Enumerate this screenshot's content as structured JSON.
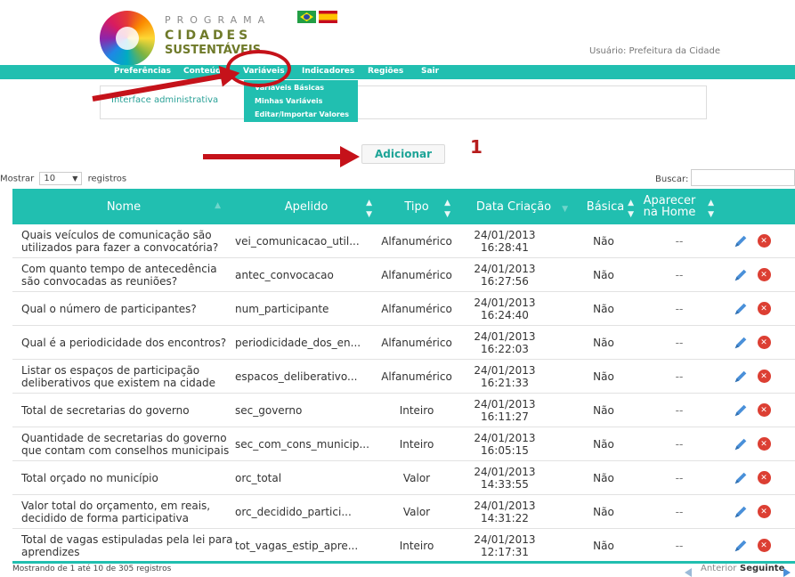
{
  "brand": {
    "line1": "PROGRAMA",
    "line2": "CIDADES",
    "line3": "SUSTENTÁVEIS"
  },
  "user_label": "Usuário: Prefeitura da Cidade",
  "nav": {
    "items": [
      "Preferências",
      "Conteúdo",
      "Variáveis",
      "Indicadores",
      "Regiões",
      "Sair"
    ],
    "active": "Variáveis"
  },
  "dropdown": {
    "items": [
      "Variáveis Básicas",
      "Minhas Variáveis",
      "Editar/Importar Valores"
    ]
  },
  "admin_panel": {
    "text": "Interface administrativa"
  },
  "add_button": "Adicionar",
  "step_label": "1",
  "length_menu": {
    "prefix": "Mostrar",
    "value": "10",
    "suffix": "registros"
  },
  "search": {
    "label": "Buscar:",
    "value": ""
  },
  "table": {
    "headers": [
      "Nome",
      "Apelido",
      "Tipo",
      "Data Criação",
      "Básica",
      "Aparecer na Home"
    ],
    "rows": [
      {
        "nome": "Quais veículos de comunicação são utilizados para fazer a convocatória?",
        "apelido": "vei_comunicacao_util...",
        "tipo": "Alfanumérico",
        "data": "24/01/2013",
        "hora": "16:28:41",
        "basica": "Não",
        "home": "--"
      },
      {
        "nome": "Com quanto tempo de antecedência são convocadas as reuniões?",
        "apelido": "antec_convocacao",
        "tipo": "Alfanumérico",
        "data": "24/01/2013",
        "hora": "16:27:56",
        "basica": "Não",
        "home": "--"
      },
      {
        "nome": "Qual o número de participantes?",
        "apelido": "num_participante",
        "tipo": "Alfanumérico",
        "data": "24/01/2013",
        "hora": "16:24:40",
        "basica": "Não",
        "home": "--"
      },
      {
        "nome": "Qual é a periodicidade dos encontros?",
        "apelido": "periodicidade_dos_en...",
        "tipo": "Alfanumérico",
        "data": "24/01/2013",
        "hora": "16:22:03",
        "basica": "Não",
        "home": "--"
      },
      {
        "nome": "Listar os espaços de participação deliberativos que existem na cidade",
        "apelido": "espacos_deliberativo...",
        "tipo": "Alfanumérico",
        "data": "24/01/2013",
        "hora": "16:21:33",
        "basica": "Não",
        "home": "--"
      },
      {
        "nome": "Total de secretarias do governo",
        "apelido": "sec_governo",
        "tipo": "Inteiro",
        "data": "24/01/2013",
        "hora": "16:11:27",
        "basica": "Não",
        "home": "--"
      },
      {
        "nome": "Quantidade de secretarias do governo que contam com conselhos municipais",
        "apelido": "sec_com_cons_municip...",
        "tipo": "Inteiro",
        "data": "24/01/2013",
        "hora": "16:05:15",
        "basica": "Não",
        "home": "--"
      },
      {
        "nome": "Total orçado no município",
        "apelido": "orc_total",
        "tipo": "Valor",
        "data": "24/01/2013",
        "hora": "14:33:55",
        "basica": "Não",
        "home": "--"
      },
      {
        "nome": "Valor total do orçamento, em reais, decidido de forma participativa",
        "apelido": "orc_decidido_partici...",
        "tipo": "Valor",
        "data": "24/01/2013",
        "hora": "14:31:22",
        "basica": "Não",
        "home": "--"
      },
      {
        "nome": "Total de vagas estipuladas pela lei para aprendizes",
        "apelido": "tot_vagas_estip_apre...",
        "tipo": "Inteiro",
        "data": "24/01/2013",
        "hora": "12:17:31",
        "basica": "Não",
        "home": "--"
      }
    ]
  },
  "footer": {
    "info": "Mostrando de 1 até 10 de 305 registros",
    "prev": "Anterior",
    "next": "Seguinte"
  },
  "colors": {
    "accent": "#21bfb0",
    "highlight": "#c5121a",
    "delete": "#dc3f33",
    "edit": "#4a90d9"
  }
}
